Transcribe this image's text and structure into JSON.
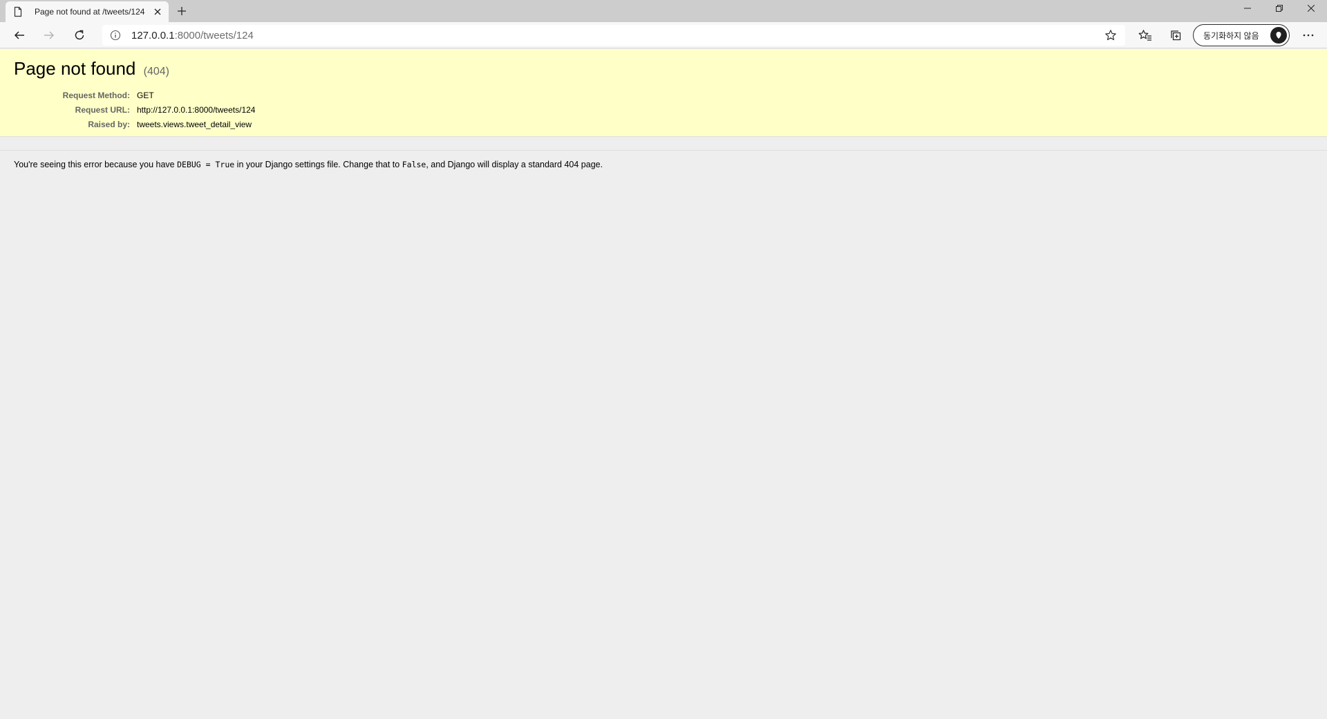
{
  "browser": {
    "tab": {
      "title": "Page not found at /tweets/124"
    },
    "address": {
      "host": "127.0.0.1",
      "rest": ":8000/tweets/124"
    },
    "profile": {
      "label": "동기화하지 않음"
    }
  },
  "page": {
    "title": "Page not found",
    "status_code": "(404)",
    "meta": [
      {
        "label": "Request Method:",
        "value": "GET"
      },
      {
        "label": "Request URL:",
        "value": "http://127.0.0.1:8000/tweets/124"
      },
      {
        "label": "Raised by:",
        "value": "tweets.views.tweet_detail_view"
      }
    ],
    "explanation": {
      "part1": "You're seeing this error because you have ",
      "code1": "DEBUG = True",
      "part2": " in your Django settings file. Change that to ",
      "code2": "False",
      "part3": ", and Django will display a standard 404 page."
    }
  },
  "icons": {
    "page": "page-icon",
    "close": "close-icon",
    "new_tab": "plus-icon",
    "back": "back-arrow-icon",
    "forward": "forward-arrow-icon",
    "refresh": "refresh-icon",
    "info": "info-icon",
    "star": "star-icon",
    "favorites": "favorites-icon",
    "collections": "collections-icon",
    "more": "more-icon"
  }
}
